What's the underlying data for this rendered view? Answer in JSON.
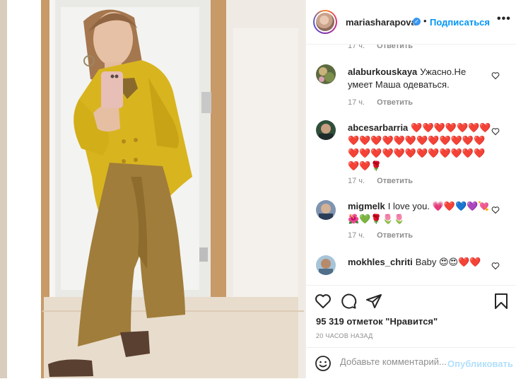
{
  "post": {
    "owner": "mariasharapova",
    "follow_label": "Подписаться",
    "separator": "•",
    "more_label": "•••",
    "likes_text": "95 319 отметок \"Нравится\"",
    "time_ago": "20 ЧАСОВ НАЗАД"
  },
  "comments": {
    "reply_label": "Ответить",
    "top_partial": {
      "time": "17 ч."
    },
    "items": [
      {
        "user": "alaburkouskaya",
        "text": "Ужасно.Не умеет Маша одеваться.",
        "time": "17 ч."
      },
      {
        "user": "abcesarbarria",
        "text": "❤️❤️❤️❤️❤️❤️❤️❤️❤️❤️❤️❤️❤️❤️❤️❤️❤️❤️❤️❤️❤️❤️❤️❤️❤️❤️❤️❤️❤️❤️❤️❤️❤️🌹",
        "time": "17 ч."
      },
      {
        "user": "migmelk",
        "text": "I love you. 💗❤️💙💜💘🌺💚🌹🌷🌷",
        "time": "17 ч."
      },
      {
        "user": "mokhles_chriti",
        "text": "Baby 😍😍❤️❤️",
        "time": ""
      }
    ]
  },
  "composer": {
    "placeholder": "Добавьте комментарий...",
    "publish_label": "Опубликовать"
  },
  "colors": {
    "accent": "#0095f6",
    "blazer": "#d8b51f",
    "pants": "#a07d3a"
  }
}
